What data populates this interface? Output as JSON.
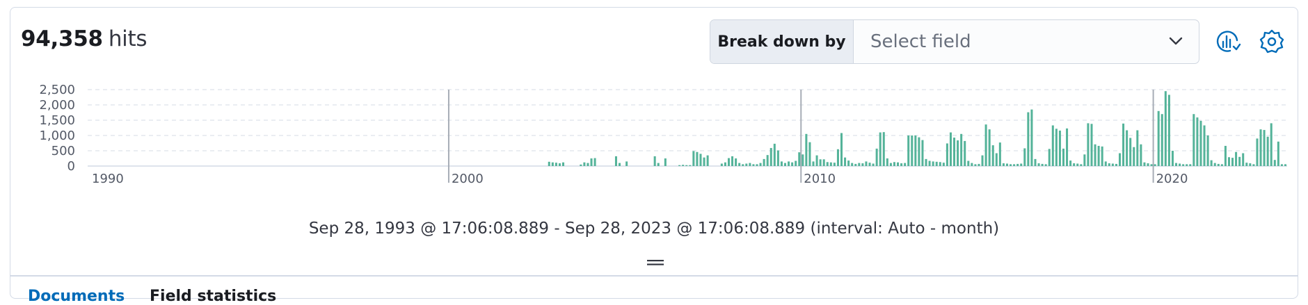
{
  "hits": {
    "count": "94,358",
    "label": "hits"
  },
  "breakdown": {
    "label": "Break down by",
    "placeholder": "Select field"
  },
  "toolbar": {
    "icons": [
      "chart-options-icon",
      "gear-icon"
    ]
  },
  "time_range": "Sep 28, 1993 @ 17:06:08.889 - Sep 28, 2023 @ 17:06:08.889 (interval: Auto - month)",
  "tabs": [
    {
      "label": "Documents",
      "active": true
    },
    {
      "label": "Field statistics",
      "active": false
    }
  ],
  "colors": {
    "bar": "#54b399",
    "accent": "#006bb8",
    "text": "#343741",
    "grid": "#e3e7ee"
  },
  "chart_data": {
    "type": "bar",
    "interval": "month",
    "y_ticks": [
      "2,500",
      "2,000",
      "1,500",
      "1,000",
      "500",
      "0"
    ],
    "ylim": [
      0,
      2500
    ],
    "x_ticks": [
      "1990",
      "2000",
      "2010",
      "2020"
    ],
    "xlim": [
      1989.75,
      2023.8
    ],
    "grid": true,
    "series": [
      {
        "values": [
          [
            2002.85,
            140
          ],
          [
            2002.95,
            120
          ],
          [
            2003.05,
            110
          ],
          [
            2003.15,
            90
          ],
          [
            2003.25,
            120
          ],
          [
            2003.75,
            50
          ],
          [
            2003.85,
            120
          ],
          [
            2003.95,
            100
          ],
          [
            2004.05,
            250
          ],
          [
            2004.15,
            260
          ],
          [
            2004.75,
            320
          ],
          [
            2004.85,
            100
          ],
          [
            2005.05,
            150
          ],
          [
            2005.85,
            320
          ],
          [
            2005.95,
            100
          ],
          [
            2006.15,
            250
          ],
          [
            2006.55,
            30
          ],
          [
            2006.65,
            40
          ],
          [
            2006.75,
            30
          ],
          [
            2006.85,
            30
          ],
          [
            2006.95,
            490
          ],
          [
            2007.05,
            460
          ],
          [
            2007.15,
            400
          ],
          [
            2007.25,
            280
          ],
          [
            2007.35,
            350
          ],
          [
            2007.75,
            80
          ],
          [
            2007.85,
            120
          ],
          [
            2007.95,
            260
          ],
          [
            2008.05,
            320
          ],
          [
            2008.15,
            250
          ],
          [
            2008.25,
            100
          ],
          [
            2008.35,
            60
          ],
          [
            2008.45,
            80
          ],
          [
            2008.55,
            100
          ],
          [
            2008.65,
            60
          ],
          [
            2008.75,
            60
          ],
          [
            2008.85,
            100
          ],
          [
            2008.95,
            230
          ],
          [
            2009.05,
            360
          ],
          [
            2009.15,
            590
          ],
          [
            2009.25,
            730
          ],
          [
            2009.35,
            510
          ],
          [
            2009.45,
            150
          ],
          [
            2009.55,
            100
          ],
          [
            2009.65,
            150
          ],
          [
            2009.75,
            120
          ],
          [
            2009.85,
            170
          ],
          [
            2009.95,
            450
          ],
          [
            2010.05,
            380
          ],
          [
            2010.15,
            1050
          ],
          [
            2010.25,
            780
          ],
          [
            2010.35,
            150
          ],
          [
            2010.45,
            350
          ],
          [
            2010.55,
            220
          ],
          [
            2010.65,
            220
          ],
          [
            2010.75,
            130
          ],
          [
            2010.85,
            120
          ],
          [
            2010.95,
            110
          ],
          [
            2011.05,
            550
          ],
          [
            2011.15,
            1080
          ],
          [
            2011.25,
            280
          ],
          [
            2011.35,
            180
          ],
          [
            2011.45,
            100
          ],
          [
            2011.55,
            70
          ],
          [
            2011.65,
            100
          ],
          [
            2011.75,
            90
          ],
          [
            2011.85,
            150
          ],
          [
            2011.95,
            110
          ],
          [
            2012.05,
            80
          ],
          [
            2012.15,
            570
          ],
          [
            2012.25,
            1100
          ],
          [
            2012.35,
            1110
          ],
          [
            2012.45,
            250
          ],
          [
            2012.55,
            100
          ],
          [
            2012.65,
            130
          ],
          [
            2012.75,
            120
          ],
          [
            2012.85,
            90
          ],
          [
            2012.95,
            100
          ],
          [
            2013.05,
            1000
          ],
          [
            2013.15,
            1000
          ],
          [
            2013.25,
            1000
          ],
          [
            2013.35,
            940
          ],
          [
            2013.45,
            850
          ],
          [
            2013.55,
            230
          ],
          [
            2013.65,
            170
          ],
          [
            2013.75,
            150
          ],
          [
            2013.85,
            140
          ],
          [
            2013.95,
            130
          ],
          [
            2014.05,
            110
          ],
          [
            2014.15,
            740
          ],
          [
            2014.25,
            1100
          ],
          [
            2014.35,
            930
          ],
          [
            2014.45,
            840
          ],
          [
            2014.55,
            1050
          ],
          [
            2014.65,
            820
          ],
          [
            2014.75,
            170
          ],
          [
            2014.85,
            100
          ],
          [
            2014.95,
            60
          ],
          [
            2015.05,
            70
          ],
          [
            2015.15,
            350
          ],
          [
            2015.25,
            1360
          ],
          [
            2015.35,
            1200
          ],
          [
            2015.45,
            680
          ],
          [
            2015.55,
            420
          ],
          [
            2015.65,
            770
          ],
          [
            2015.75,
            90
          ],
          [
            2015.85,
            80
          ],
          [
            2015.95,
            60
          ],
          [
            2016.05,
            60
          ],
          [
            2016.15,
            70
          ],
          [
            2016.25,
            80
          ],
          [
            2016.35,
            580
          ],
          [
            2016.45,
            1760
          ],
          [
            2016.55,
            1850
          ],
          [
            2016.65,
            230
          ],
          [
            2016.75,
            90
          ],
          [
            2016.85,
            70
          ],
          [
            2016.95,
            60
          ],
          [
            2017.05,
            560
          ],
          [
            2017.15,
            1330
          ],
          [
            2017.25,
            1220
          ],
          [
            2017.35,
            1160
          ],
          [
            2017.45,
            570
          ],
          [
            2017.55,
            1230
          ],
          [
            2017.65,
            180
          ],
          [
            2017.75,
            90
          ],
          [
            2017.85,
            80
          ],
          [
            2017.95,
            60
          ],
          [
            2018.05,
            380
          ],
          [
            2018.15,
            1400
          ],
          [
            2018.25,
            1380
          ],
          [
            2018.35,
            710
          ],
          [
            2018.45,
            660
          ],
          [
            2018.55,
            640
          ],
          [
            2018.65,
            150
          ],
          [
            2018.75,
            90
          ],
          [
            2018.85,
            80
          ],
          [
            2018.95,
            70
          ],
          [
            2019.05,
            420
          ],
          [
            2019.15,
            1390
          ],
          [
            2019.25,
            1170
          ],
          [
            2019.35,
            920
          ],
          [
            2019.45,
            620
          ],
          [
            2019.55,
            1170
          ],
          [
            2019.65,
            710
          ],
          [
            2019.75,
            120
          ],
          [
            2019.85,
            90
          ],
          [
            2019.95,
            60
          ],
          [
            2020.05,
            60
          ],
          [
            2020.15,
            1800
          ],
          [
            2020.25,
            1700
          ],
          [
            2020.35,
            2450
          ],
          [
            2020.45,
            2330
          ],
          [
            2020.55,
            500
          ],
          [
            2020.65,
            100
          ],
          [
            2020.75,
            80
          ],
          [
            2020.85,
            60
          ],
          [
            2020.95,
            60
          ],
          [
            2021.05,
            60
          ],
          [
            2021.15,
            1700
          ],
          [
            2021.25,
            1590
          ],
          [
            2021.35,
            1480
          ],
          [
            2021.45,
            1330
          ],
          [
            2021.55,
            1000
          ],
          [
            2021.65,
            190
          ],
          [
            2021.75,
            100
          ],
          [
            2021.85,
            70
          ],
          [
            2021.95,
            60
          ],
          [
            2022.05,
            660
          ],
          [
            2022.15,
            290
          ],
          [
            2022.25,
            270
          ],
          [
            2022.35,
            460
          ],
          [
            2022.45,
            300
          ],
          [
            2022.55,
            420
          ],
          [
            2022.65,
            110
          ],
          [
            2022.75,
            90
          ],
          [
            2022.85,
            60
          ],
          [
            2022.95,
            900
          ],
          [
            2023.05,
            1200
          ],
          [
            2023.15,
            1180
          ],
          [
            2023.25,
            960
          ],
          [
            2023.35,
            1400
          ],
          [
            2023.45,
            200
          ],
          [
            2023.55,
            800
          ],
          [
            2023.65,
            60
          ],
          [
            2023.75,
            60
          ]
        ]
      }
    ]
  }
}
